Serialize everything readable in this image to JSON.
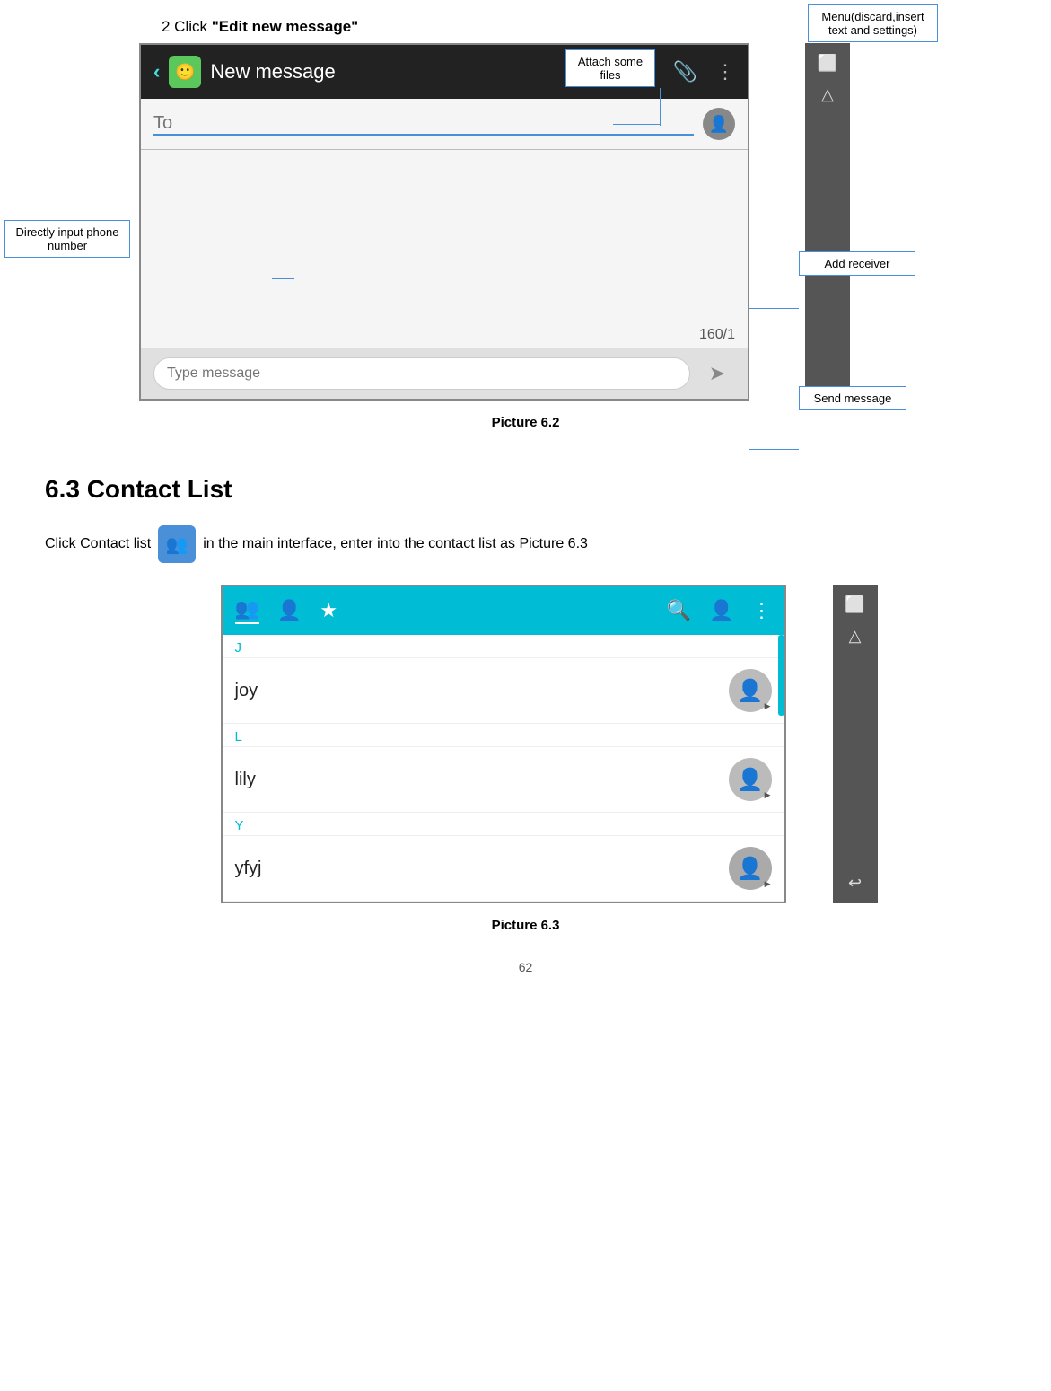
{
  "page": {
    "click_label": "2 Click “Edit new message”",
    "picture_62_caption": "Picture 6.2",
    "picture_63_caption": "Picture 6.3",
    "page_number": "62",
    "section_63_heading": "6.3 Contact List",
    "contact_desc_pre": "Click Contact list",
    "contact_desc_post": "in the main interface, enter into the contact list as Picture 6.3"
  },
  "annotations": {
    "attach_files": "Attach\nsome files",
    "menu": "Menu(discard,insert\ntext and settings)",
    "directly_input": "Directly    input\nphone number",
    "add_receiver": "Add receiver",
    "send_message": "Send\nmessage"
  },
  "new_message": {
    "back_icon": "‹",
    "header_emoji": "🙂",
    "title": "New message",
    "attach_icon": "📎",
    "menu_icon": "⋮",
    "to_placeholder": "To",
    "char_count": "160/1",
    "type_placeholder": "Type message",
    "send_icon": "➤"
  },
  "contact_list": {
    "header_icons": [
      "👥",
      "👤",
      "★",
      "🔍",
      "👤₊",
      "⋮"
    ],
    "groups": [
      {
        "label": "J",
        "contacts": [
          {
            "name": "joy"
          }
        ]
      },
      {
        "label": "L",
        "contacts": [
          {
            "name": "lily"
          }
        ]
      },
      {
        "label": "Y",
        "contacts": [
          {
            "name": "yfyj"
          }
        ]
      }
    ]
  }
}
